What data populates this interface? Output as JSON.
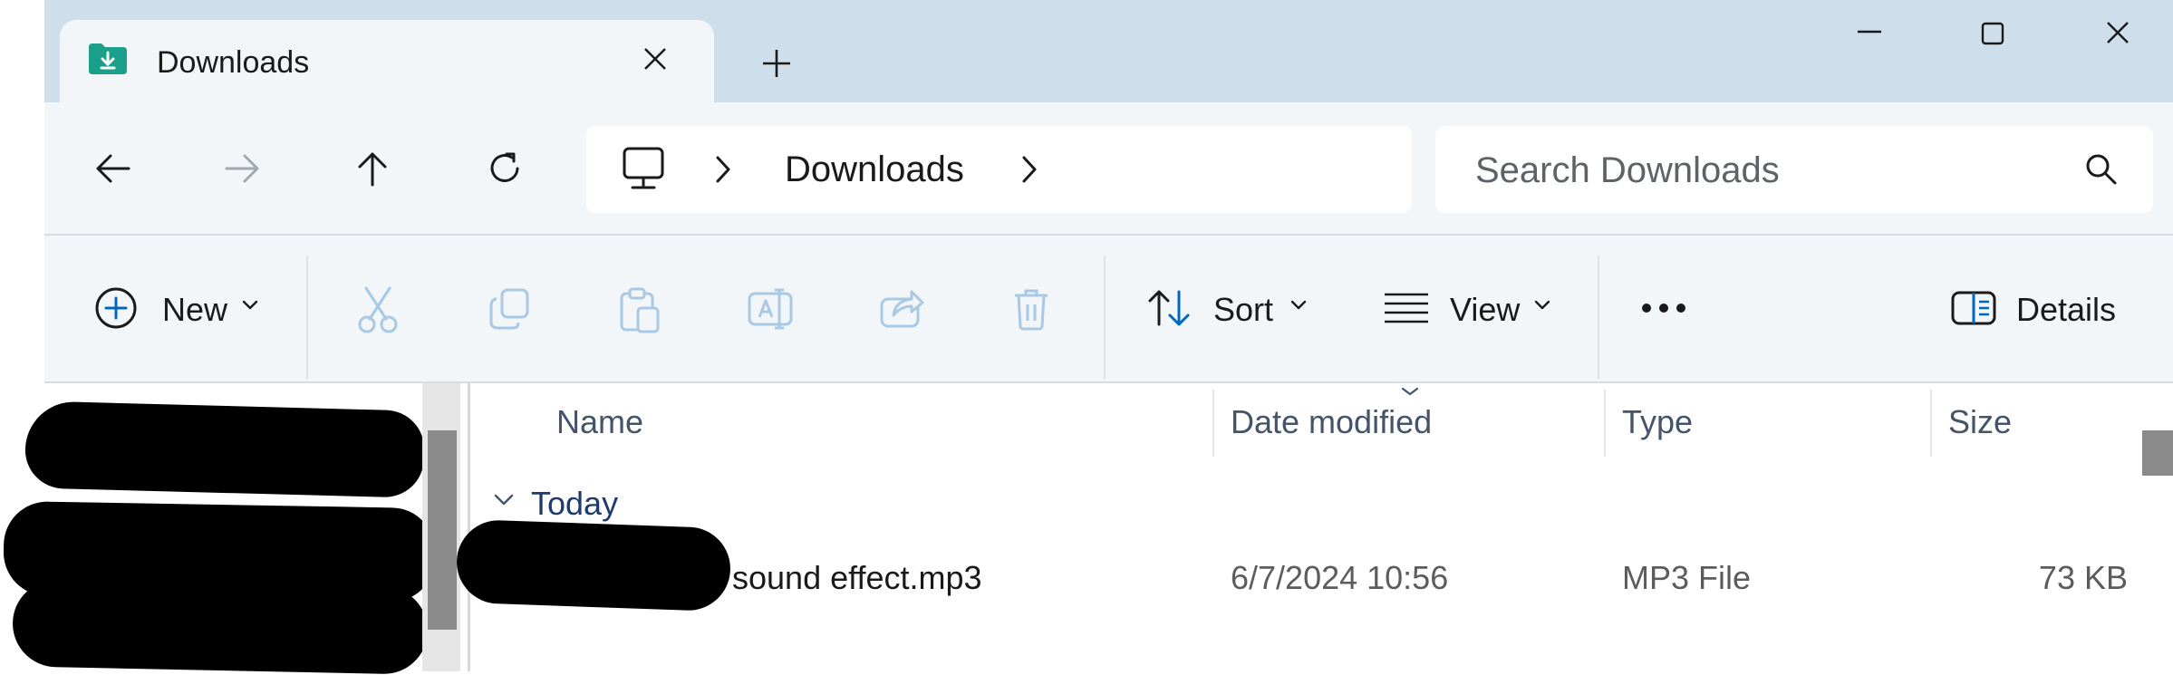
{
  "window": {
    "tab_title": "Downloads",
    "tab_icon": "downloads-folder-icon",
    "new_tab_icon": "plus-icon",
    "controls": [
      "minimize-icon",
      "maximize-icon",
      "close-icon"
    ]
  },
  "navigation": {
    "breadcrumb": [
      "Downloads"
    ],
    "search_placeholder": "Search Downloads"
  },
  "commands": {
    "new_label": "New",
    "sort_label": "Sort",
    "view_label": "View",
    "details_label": "Details",
    "disabled_actions": [
      "cut-icon",
      "copy-icon",
      "paste-icon",
      "rename-icon",
      "share-icon",
      "delete-icon"
    ]
  },
  "columns": {
    "name": "Name",
    "date_modified": "Date modified",
    "type": "Type",
    "size": "Size"
  },
  "groups": [
    {
      "label": "Today",
      "files": [
        {
          "name": "sound effect.mp3",
          "date_modified": "6/7/2024 10:56",
          "type": "MP3 File",
          "size": "73 KB"
        }
      ]
    }
  ],
  "colors": {
    "title_bar": "#cfdeeb",
    "toolbar": "#f3f6f9",
    "accent": "#0067c0",
    "folder_icon": "#1aa08a"
  }
}
